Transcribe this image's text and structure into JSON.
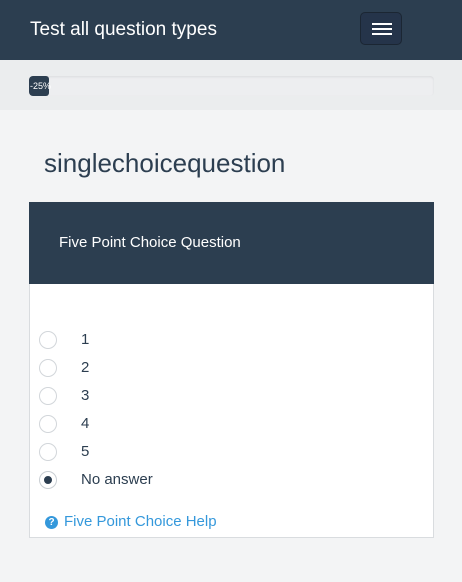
{
  "navbar": {
    "brand": "Test all question types",
    "menu_icon": "hamburger-menu-icon"
  },
  "progress": {
    "label": "-25%",
    "value_percent": 5
  },
  "group": {
    "title": "singlechoicequestion"
  },
  "question": {
    "text": "Five Point Choice Question",
    "answers": [
      {
        "label": "1",
        "checked": false
      },
      {
        "label": "2",
        "checked": false
      },
      {
        "label": "3",
        "checked": false
      },
      {
        "label": "4",
        "checked": false
      },
      {
        "label": "5",
        "checked": false
      },
      {
        "label": "No answer",
        "checked": true
      }
    ],
    "help": {
      "icon": "question-circle-icon",
      "text": "Five Point Choice Help"
    }
  },
  "colors": {
    "primary": "#2c3e50",
    "link": "#3498db",
    "background": "#f3f4f5"
  }
}
